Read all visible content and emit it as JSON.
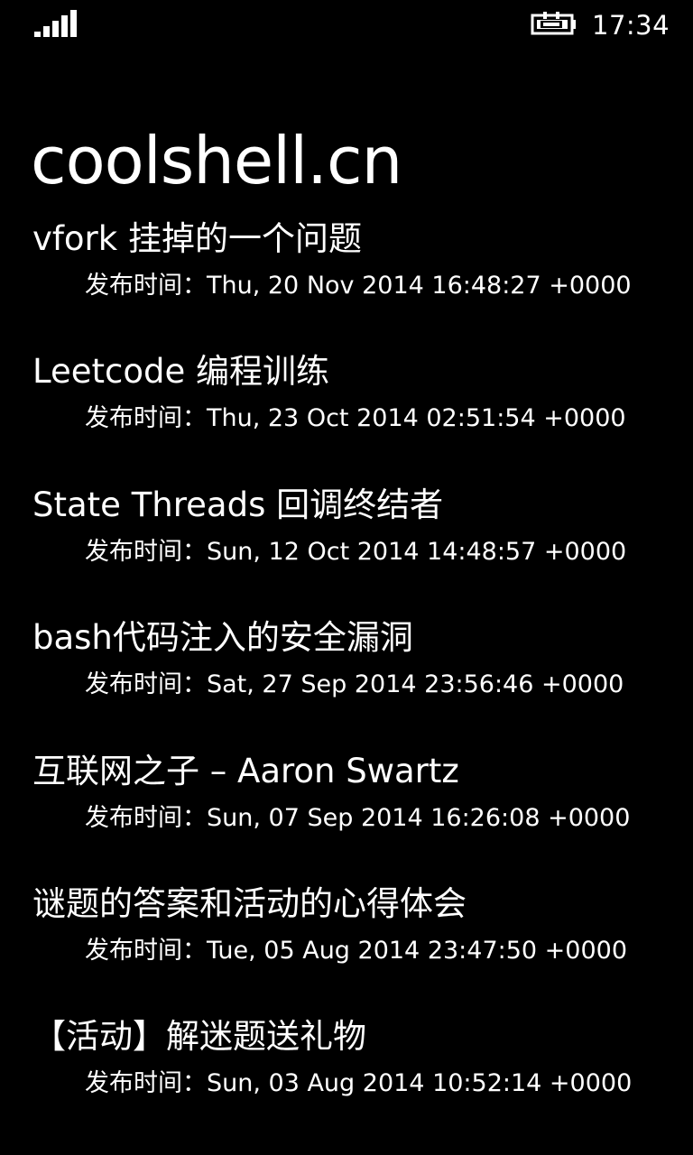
{
  "status_bar": {
    "time": "17:34",
    "signal_icon": "signal-strength-icon",
    "battery_icon": "battery-charging-icon"
  },
  "app": {
    "title": "coolshell.cn"
  },
  "posts": [
    {
      "title": "vfork 挂掉的一个问题",
      "date": "发布时间：Thu, 20 Nov 2014 16:48:27 +0000"
    },
    {
      "title": "Leetcode 编程训练",
      "date": "发布时间：Thu, 23 Oct 2014 02:51:54 +0000"
    },
    {
      "title": "State Threads 回调终结者",
      "date": "发布时间：Sun, 12 Oct 2014 14:48:57 +0000"
    },
    {
      "title": "bash代码注入的安全漏洞",
      "date": "发布时间：Sat, 27 Sep 2014 23:56:46 +0000"
    },
    {
      "title": "互联网之子 – Aaron Swartz",
      "date": "发布时间：Sun, 07 Sep 2014 16:26:08 +0000"
    },
    {
      "title": "谜题的答案和活动的心得体会",
      "date": "发布时间：Tue, 05 Aug 2014 23:47:50 +0000"
    },
    {
      "title": "【活动】解迷题送礼物",
      "date": "发布时间：Sun, 03 Aug 2014 10:52:14 +0000"
    }
  ],
  "colors": {
    "background": "#000000",
    "foreground": "#ffffff"
  }
}
